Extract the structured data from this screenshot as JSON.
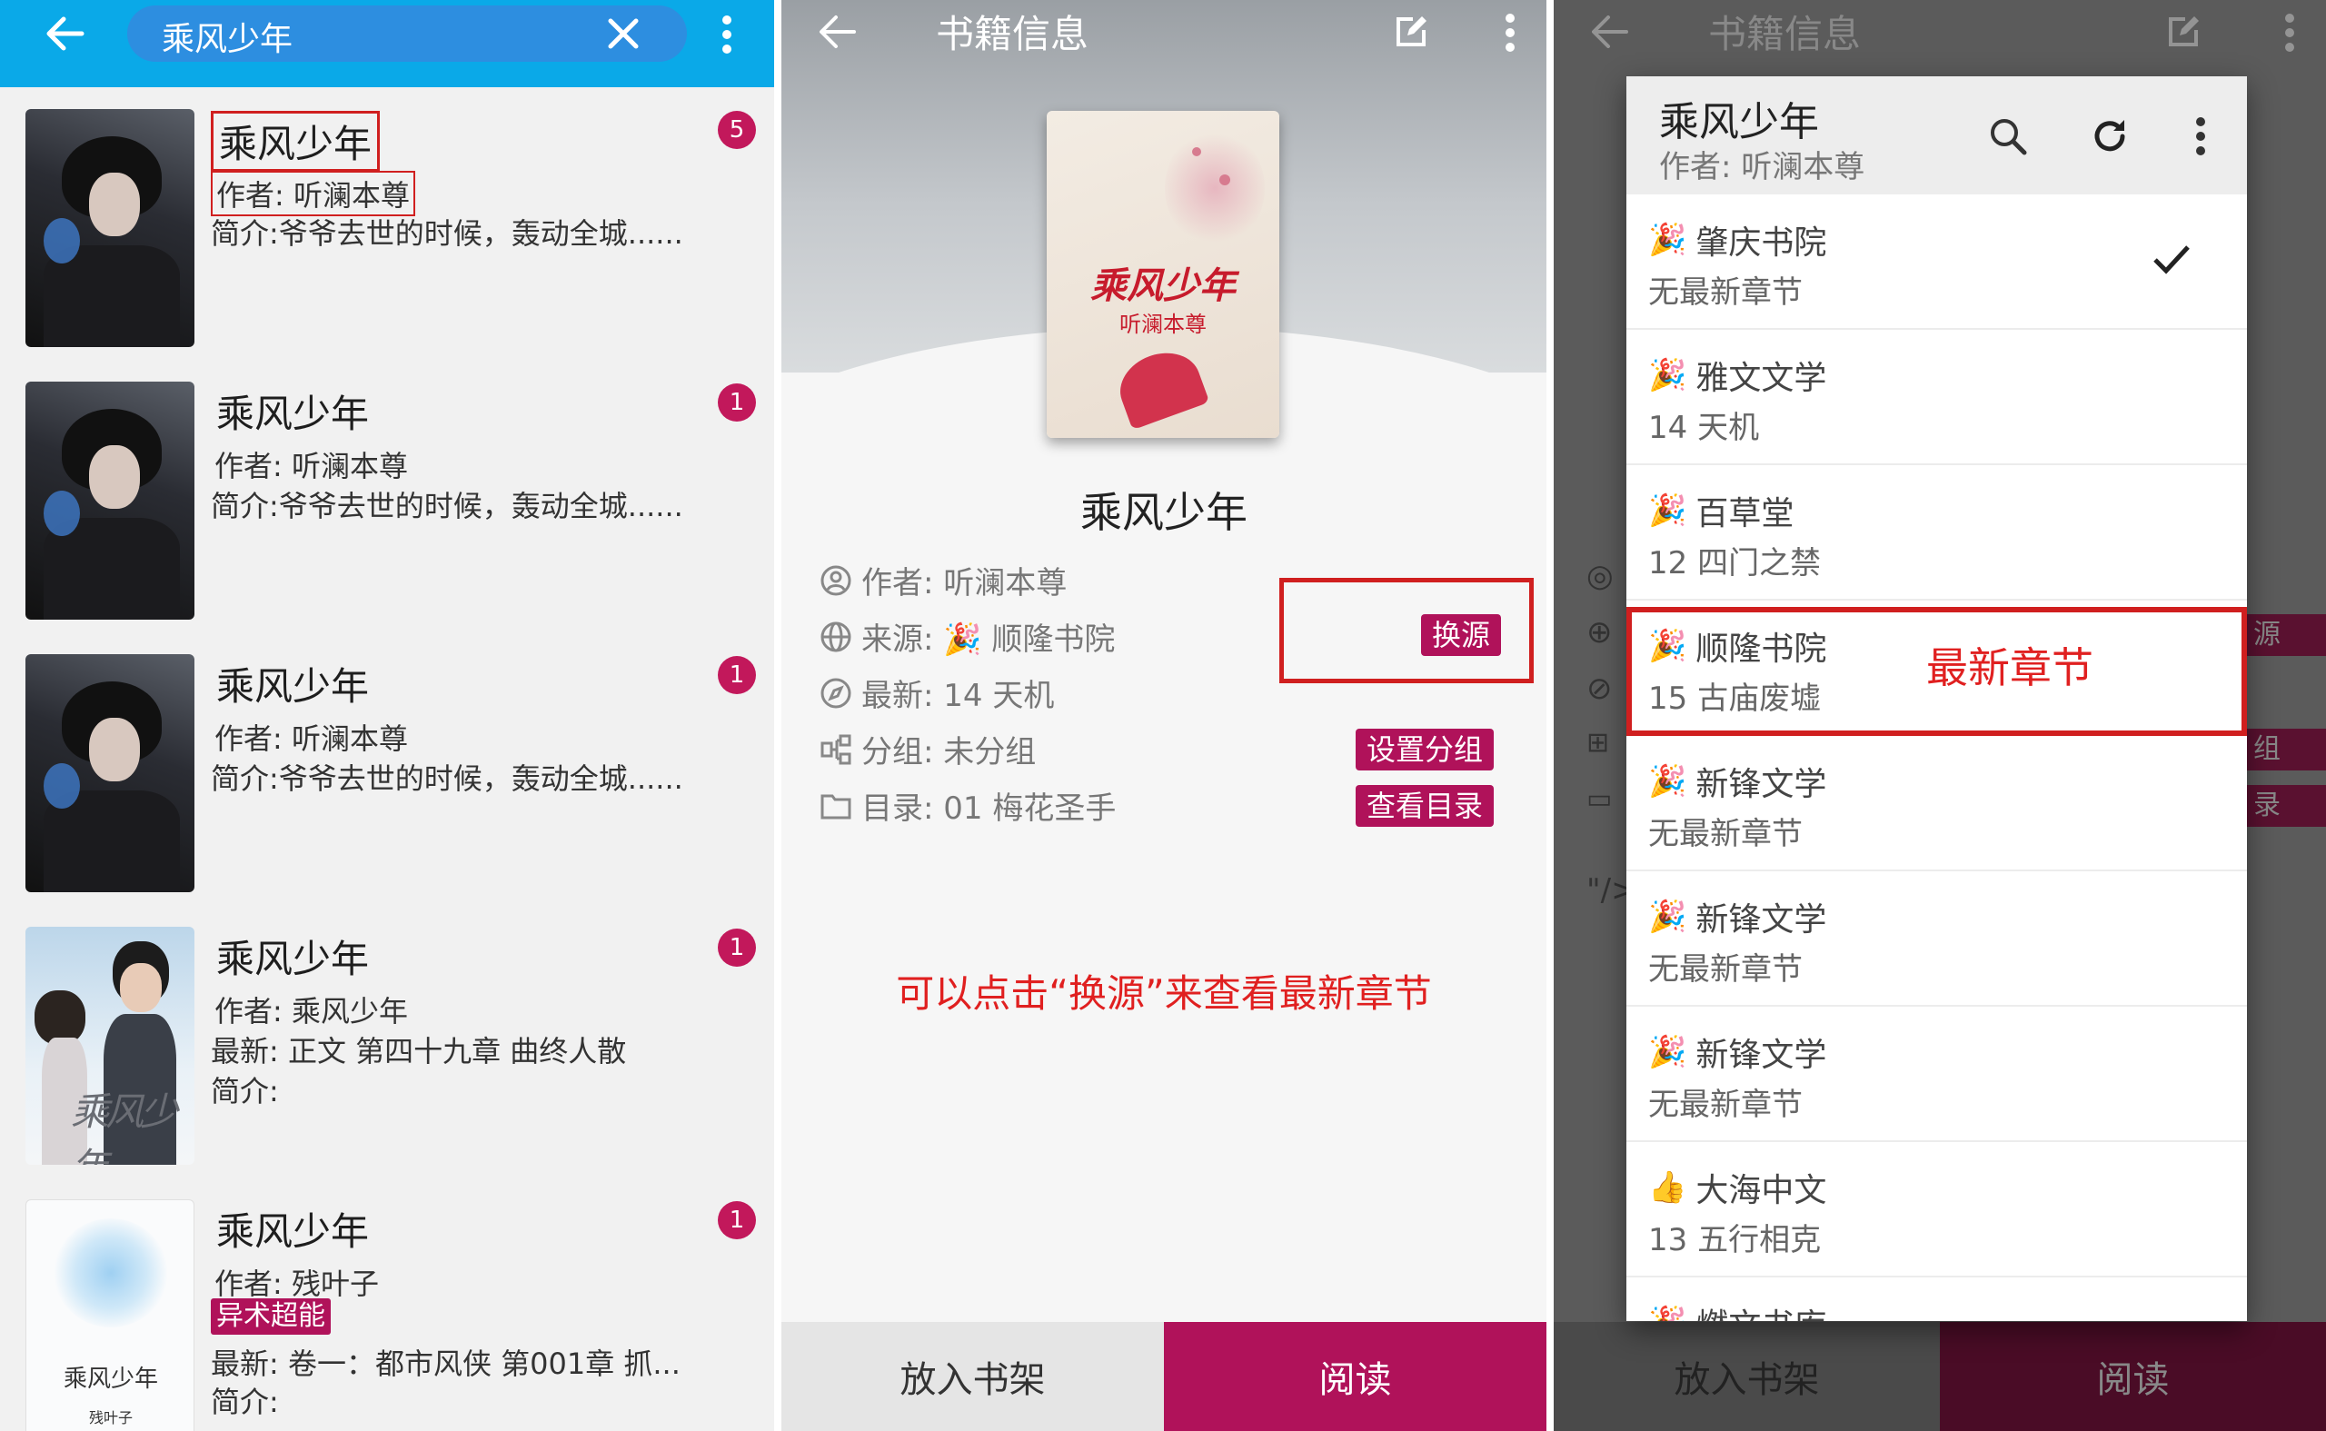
{
  "left": {
    "search_query": "乘风少年",
    "results": [
      {
        "title": "乘风少年",
        "badge": "5",
        "author": "作者: 听澜本尊",
        "line3": "简介:爷爷去世的时候，轰动全城......",
        "tag": "",
        "line4": ""
      },
      {
        "title": "乘风少年",
        "badge": "1",
        "author": "作者: 听澜本尊",
        "line3": "简介:爷爷去世的时候，轰动全城......",
        "tag": "",
        "line4": ""
      },
      {
        "title": "乘风少年",
        "badge": "1",
        "author": "作者: 听澜本尊",
        "line3": "简介:爷爷去世的时候，轰动全城......",
        "tag": "",
        "line4": ""
      },
      {
        "title": "乘风少年",
        "badge": "1",
        "author": "作者: 乘风少年",
        "line3": "最新: 正文 第四十九章 曲终人散",
        "tag": "",
        "line4": "简介:"
      },
      {
        "title": "乘风少年",
        "badge": "1",
        "author": "作者: 残叶子",
        "tag": "异术超能",
        "line3": "最新: 卷一：都市风侠 第001章 抓...",
        "line4": "简介:"
      }
    ],
    "cover_texts": {
      "c4": "乘风少年",
      "c5": "乘风少年",
      "c5_author": "残叶子"
    }
  },
  "middle": {
    "title": "书籍信息",
    "cover_title": "乘风少年",
    "cover_author": "听澜本尊",
    "book_name": "乘风少年",
    "author": "作者: 听澜本尊",
    "source": "来源: 🎉 顺隆书院",
    "latest": "最新: 14 天机",
    "group": "分组: 未分组",
    "toc": "目录: 01 梅花圣手",
    "btn_change_source": "换源",
    "btn_set_group": "设置分组",
    "btn_view_toc": "查看目录",
    "annotation": "可以点击“换源”来查看最新章节",
    "btn_shelf": "放入书架",
    "btn_read": "阅读"
  },
  "right": {
    "bg_title": "书籍信息",
    "dialog_title": "乘风少年",
    "dialog_author": "作者: 听澜本尊",
    "annotation": "最新章节",
    "bg_text": "\"/>",
    "bg_btn_source": "源",
    "bg_btn_group": "组",
    "bg_btn_toc": "录",
    "sources": [
      {
        "icon": "🎉",
        "name": "肇庆书院",
        "latest": "无最新章节",
        "checked": true
      },
      {
        "icon": "🎉",
        "name": "雅文文学",
        "latest": "14 天机",
        "checked": false
      },
      {
        "icon": "🎉",
        "name": "百草堂",
        "latest": "12 四门之禁",
        "checked": false
      },
      {
        "icon": "🎉",
        "name": "顺隆书院",
        "latest": "15 古庙废墟",
        "checked": false
      },
      {
        "icon": "🎉",
        "name": "新锋文学",
        "latest": "无最新章节",
        "checked": false
      },
      {
        "icon": "🎉",
        "name": "新锋文学",
        "latest": "无最新章节",
        "checked": false
      },
      {
        "icon": "🎉",
        "name": "新锋文学",
        "latest": "无最新章节",
        "checked": false
      },
      {
        "icon": "👍",
        "name": "大海中文",
        "latest": "13 五行相克",
        "checked": false
      },
      {
        "icon": "🎉",
        "name": "燃文书库",
        "latest": "",
        "checked": false
      }
    ],
    "btn_shelf": "放入书架",
    "btn_read": "阅读"
  },
  "colors": {
    "search_bar": "#0aa9e8",
    "accent": "#b0125a",
    "badge": "#c2185b",
    "annotation_red": "#e02020",
    "highlight_box": "#d01f1f"
  }
}
